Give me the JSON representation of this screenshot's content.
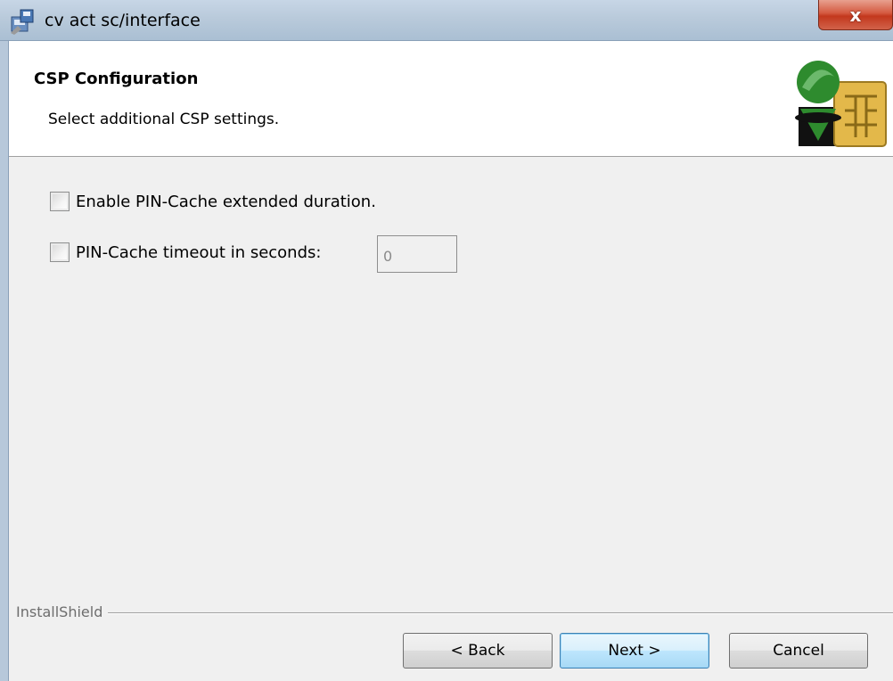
{
  "window": {
    "title": "cv act sc/interface",
    "close_label": "x"
  },
  "banner": {
    "heading": "CSP Configuration",
    "subheading": "Select additional CSP settings."
  },
  "options": {
    "extended_duration": {
      "label": "Enable PIN-Cache extended duration.",
      "checked": false
    },
    "timeout": {
      "label": "PIN-Cache timeout in seconds:",
      "checked": false,
      "value": "0"
    }
  },
  "footer": {
    "brand": "InstallShield",
    "back_label": "< Back",
    "next_label": "Next >",
    "cancel_label": "Cancel"
  },
  "colors": {
    "accent": "#3c7fb1",
    "close": "#c3381d",
    "logo_green": "#2e8b2e",
    "logo_gold": "#e3b84a"
  }
}
